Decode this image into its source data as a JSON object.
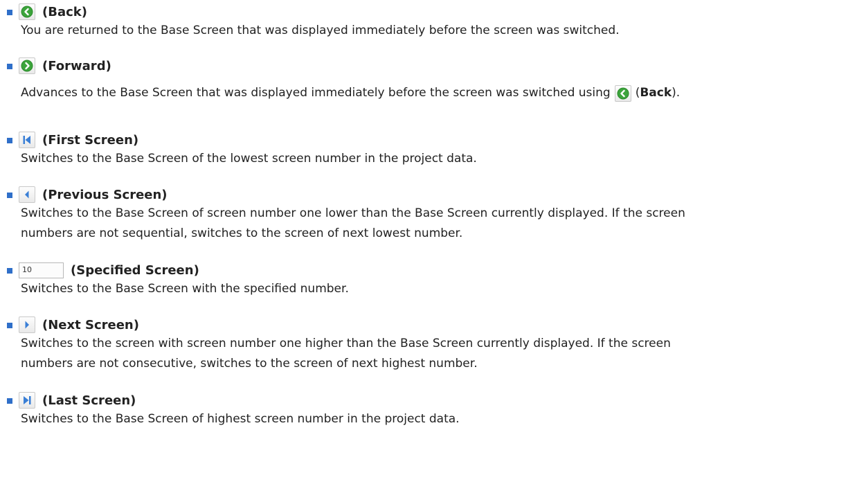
{
  "colors": {
    "bullet": "#2f6fc9",
    "text": "#222222",
    "green_icon": "#3ca43c",
    "blue_icon": "#3a7fd6"
  },
  "items": [
    {
      "icon": "back-arrow-icon",
      "title": "(Back)",
      "description": "You are returned to the Base Screen that was displayed immediately before the screen was switched."
    },
    {
      "icon": "forward-arrow-icon",
      "title": "(Forward)",
      "description_before": "Advances to the Base Screen that was displayed immediately before the screen was switched using",
      "description_open_paren": "(",
      "description_bold": "Back",
      "description_after": ")."
    },
    {
      "icon": "first-screen-icon",
      "title": "(First Screen)",
      "description": "Switches to the Base Screen of the lowest screen number in the project data."
    },
    {
      "icon": "previous-screen-icon",
      "title": "(Previous Screen)",
      "description_line1": "Switches to the Base Screen of screen number one lower than the Base Screen currently displayed. If the screen",
      "description_line2": "numbers are not sequential, switches to the screen of next lowest number."
    },
    {
      "icon": "screen-number-input",
      "input_value": "10",
      "title": "(Specified Screen)",
      "description": "Switches to the Base Screen with the specified number."
    },
    {
      "icon": "next-screen-icon",
      "title": "(Next Screen)",
      "description_line1": "Switches to the screen with screen number one higher than the Base Screen currently displayed. If the screen",
      "description_line2": "numbers are not consecutive, switches to the screen of next highest number."
    },
    {
      "icon": "last-screen-icon",
      "title": "(Last Screen)",
      "description": "Switches to the Base Screen of highest screen number in the project data."
    }
  ]
}
